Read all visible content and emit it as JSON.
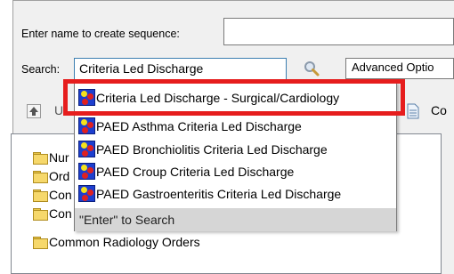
{
  "form": {
    "name_label": "Enter name to create sequence:",
    "name_value": "",
    "search_label": "Search:",
    "search_value": "Criteria Led Discharge",
    "advanced_label": "Advanced Optio"
  },
  "toolbar": {
    "up_label": "U",
    "right_label": "Co"
  },
  "tree": {
    "items": [
      {
        "label": "Nur"
      },
      {
        "label": "Ord"
      },
      {
        "label": "Con"
      },
      {
        "label": "Con"
      },
      {
        "label": "Common Radiology Orders"
      }
    ]
  },
  "dropdown": {
    "items": [
      {
        "label": "Criteria Led Discharge - Surgical/Cardiology"
      },
      {
        "label": "PAED Asthma Criteria Led Discharge"
      },
      {
        "label": "PAED Bronchiolitis Criteria Led Discharge"
      },
      {
        "label": "PAED Croup Criteria Led Discharge"
      },
      {
        "label": "PAED Gastroenteritis Criteria Led Discharge"
      }
    ],
    "enter_hint": "\"Enter\" to Search"
  },
  "colors": {
    "highlight": "#e61d1d",
    "icon_blue": "#1d3fcf"
  }
}
